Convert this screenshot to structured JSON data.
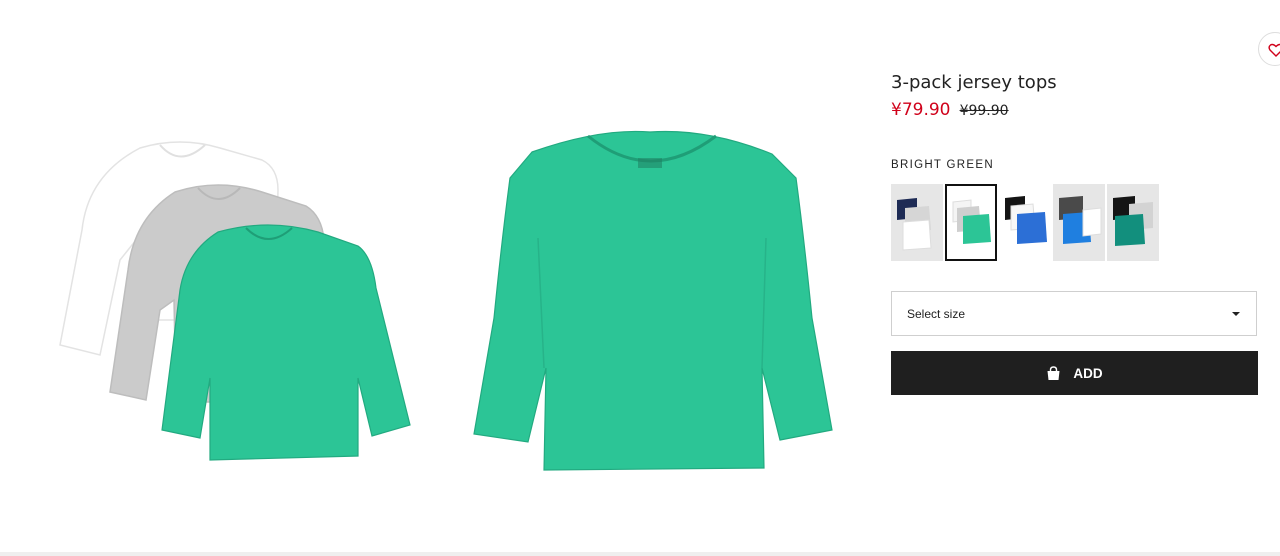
{
  "product": {
    "title": "3-pack jersey tops",
    "price_sale": "¥79.90",
    "price_original": "¥99.90",
    "color_name": "BRIGHT GREEN"
  },
  "swatches": [
    {
      "name": "navy-grey-white"
    },
    {
      "name": "white-grey-green",
      "selected": true
    },
    {
      "name": "black-white-blue"
    },
    {
      "name": "grey-blue-white"
    },
    {
      "name": "black-grey-teal"
    }
  ],
  "size_select": {
    "placeholder": "Select size"
  },
  "add_button": {
    "label": "ADD",
    "icon": "shopping-bag-icon"
  },
  "favorite_button": {
    "icon": "heart-icon"
  },
  "colors": {
    "sale_price": "#d0021b",
    "button_bg": "#1f1f1f",
    "shirt_green": "#2cc596",
    "shirt_grey": "#cfcfcf"
  }
}
